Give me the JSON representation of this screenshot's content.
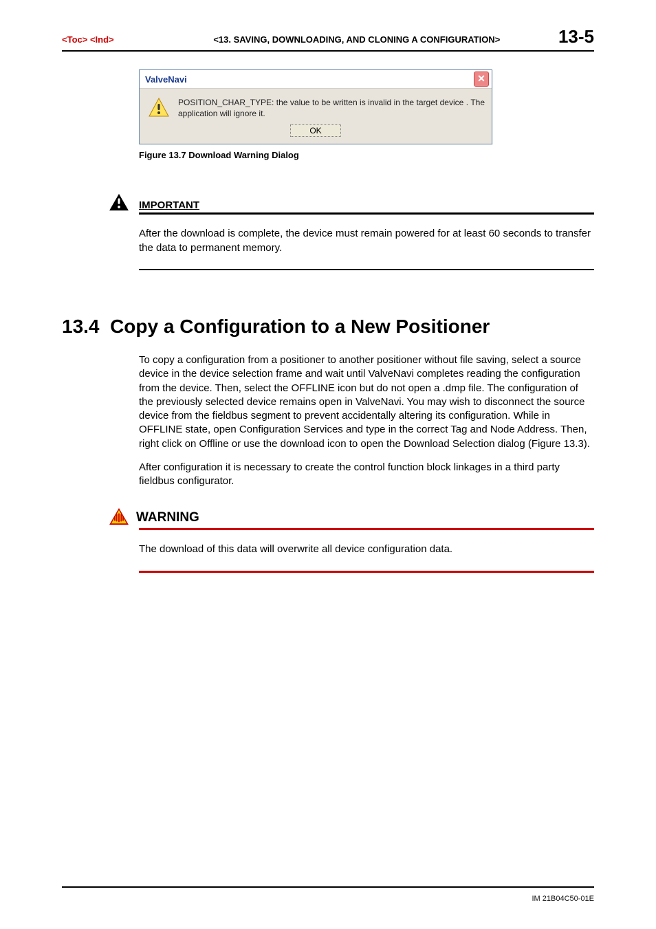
{
  "header": {
    "toc": "<Toc>",
    "ind": "<Ind>",
    "chapter": "<13.  SAVING, DOWNLOADING, AND CLONING A CONFIGURATION>",
    "page": "13-5"
  },
  "dialog": {
    "title": "ValveNavi",
    "message": "POSITION_CHAR_TYPE: the value to be written is invalid in the target device . The application will ignore it.",
    "ok": "OK"
  },
  "figure_caption": "Figure 13.7  Download Warning Dialog",
  "important": {
    "label": "IMPORTANT",
    "text": "After the download is complete, the device must remain powered for at least 60 seconds to transfer the data to permanent memory."
  },
  "section": {
    "number": "13.4",
    "title": "Copy a Configuration to a New Positioner",
    "para1": "To copy a configuration from a positioner to another positioner without file saving, select a source device in the device selection frame and wait until ValveNavi completes reading the configuration from the device.  Then, select the OFFLINE icon but do not open a .dmp file.  The configuration of the previously selected device remains open in ValveNavi.  You may wish to disconnect the source device from the fieldbus segment to prevent accidentally altering its configuration.  While in OFFLINE state, open Configuration Services and type in the correct Tag and Node Address.  Then, right click on Offline or use the download icon to open the Download Selection dialog (Figure 13.3).",
    "para2": "After configuration it is necessary to create the control function block linkages in a third party fieldbus configurator."
  },
  "warning": {
    "label": "WARNING",
    "text": "The download of this data will overwrite all device configuration data."
  },
  "footer": "IM 21B04C50-01E"
}
